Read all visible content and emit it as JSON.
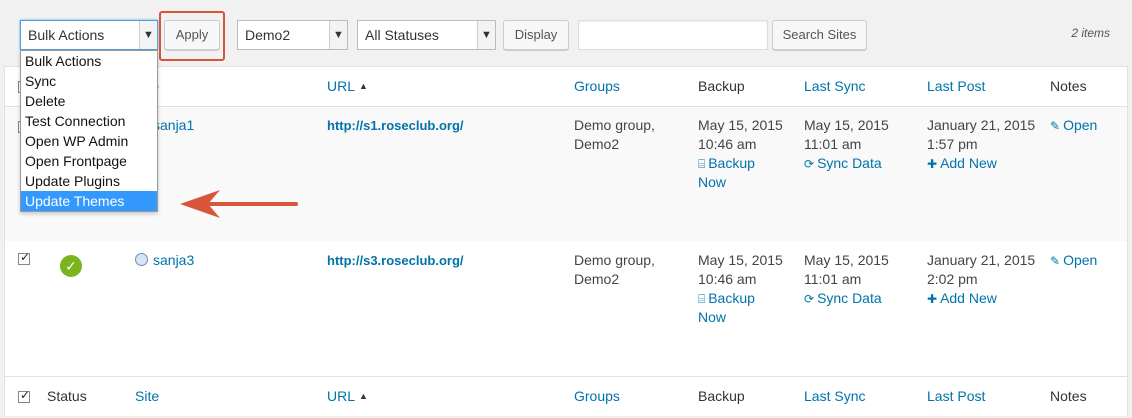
{
  "toolbar": {
    "bulk_actions": "Bulk Actions",
    "apply": "Apply",
    "group_filter": "Demo2",
    "status_filter": "All Statuses",
    "display": "Display",
    "search_value": "",
    "search_sites": "Search Sites",
    "items_count": "2 items"
  },
  "dropdown": {
    "options": [
      "Bulk Actions",
      "Sync",
      "Delete",
      "Test Connection",
      "Open WP Admin",
      "Open Frontpage",
      "Update Plugins",
      "Update Themes"
    ],
    "selected": "Update Themes"
  },
  "columns": {
    "status": "Status",
    "site": "Site",
    "url": "URL",
    "groups": "Groups",
    "backup": "Backup",
    "last_sync": "Last Sync",
    "last_post": "Last Post",
    "notes": "Notes"
  },
  "rows": [
    {
      "site": "sanja1",
      "url": "http://s1.roseclub.org/",
      "groups_line1": "Demo group,",
      "groups_line2": "Demo2",
      "backup_date": "May 15, 2015",
      "backup_time": "10:46 am",
      "backup_link1": "Backup",
      "backup_link2": "Now",
      "sync_date": "May 15, 2015",
      "sync_time": "11:01 am",
      "sync_link": "Sync Data",
      "post_date": "January 21, 2015",
      "post_time": "1:57 pm",
      "post_link": "Add New",
      "notes_link": "Open"
    },
    {
      "site": "sanja3",
      "url": "http://s3.roseclub.org/",
      "groups_line1": "Demo group,",
      "groups_line2": "Demo2",
      "backup_date": "May 15, 2015",
      "backup_time": "10:46 am",
      "backup_link1": "Backup",
      "backup_link2": "Now",
      "sync_date": "May 15, 2015",
      "sync_time": "11:01 am",
      "sync_link": "Sync Data",
      "post_date": "January 21, 2015",
      "post_time": "2:02 pm",
      "post_link": "Add New",
      "notes_link": "Open"
    }
  ],
  "icons": {
    "sort": "▲",
    "status_ok": "✓",
    "backup": "hdd-icon",
    "sync": "refresh-icon",
    "add": "plus-icon",
    "notes": "edit-icon"
  },
  "colors": {
    "link": "#0073aa",
    "highlight": "#d7553a",
    "selected": "#3399ff",
    "status_ok": "#7ab51d"
  }
}
